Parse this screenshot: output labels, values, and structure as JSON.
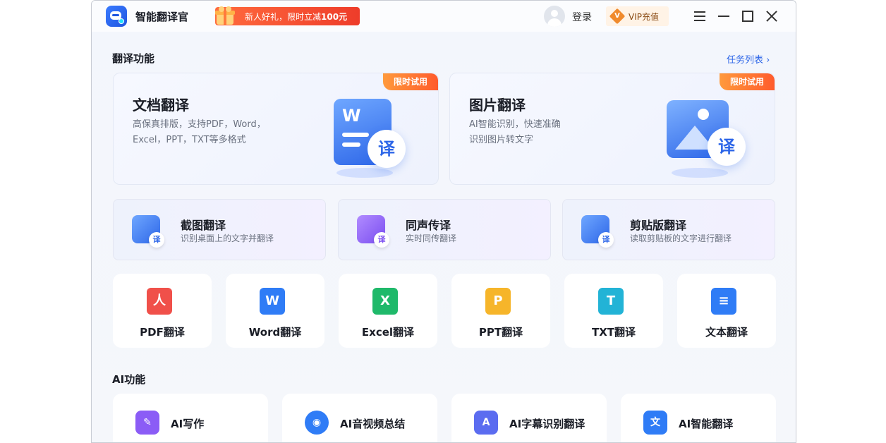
{
  "app": {
    "title": "智能翻译官"
  },
  "promo": {
    "text": "新人好礼，限时立减",
    "amount": "100元"
  },
  "header": {
    "login": "登录",
    "vip_badge": "V",
    "vip": "VIP充值"
  },
  "sections": {
    "translate": "翻译功能",
    "ai": "AI功能",
    "task_list": "任务列表 ›"
  },
  "big_cards": [
    {
      "badge": "限时试用",
      "title": "文档翻译",
      "desc1": "高保真排版，支持PDF，Word，",
      "desc2": "Excel，PPT，TXT等多格式",
      "icon_text": "W",
      "yi": "译"
    },
    {
      "badge": "限时试用",
      "title": "图片翻译",
      "desc1": "AI智能识别，快速准确",
      "desc2": "识别图片转文字",
      "yi": "译"
    }
  ],
  "mid_cards": [
    {
      "title": "截图翻译",
      "desc": "识别桌面上的文字并翻译",
      "yi": "译"
    },
    {
      "title": "同声传译",
      "desc": "实时同传翻译",
      "yi": "译"
    },
    {
      "title": "剪贴版翻译",
      "desc": "读取剪贴板的文字进行翻译",
      "yi": "译"
    }
  ],
  "format_cards": [
    {
      "label": "PDF翻译",
      "icon": "人",
      "color": "#f0504a"
    },
    {
      "label": "Word翻译",
      "icon": "W",
      "color": "#2f7cf6"
    },
    {
      "label": "Excel翻译",
      "icon": "X",
      "color": "#1fb96a"
    },
    {
      "label": "PPT翻译",
      "icon": "P",
      "color": "#f6b52a"
    },
    {
      "label": "TXT翻译",
      "icon": "T",
      "color": "#22b3d6"
    },
    {
      "label": "文本翻译",
      "icon": "≡",
      "color": "#2f7cf6"
    }
  ],
  "ai_cards": [
    {
      "label": "AI写作",
      "icon": "✎",
      "color": "#8b5cf6"
    },
    {
      "label": "AI音视频总结",
      "icon": "◉",
      "color": "#2f7cf6"
    },
    {
      "label": "AI字幕识别翻译",
      "icon": "A",
      "color": "#5b6cf0"
    },
    {
      "label": "AI智能翻译",
      "icon": "文",
      "color": "#2f7cf6"
    }
  ]
}
